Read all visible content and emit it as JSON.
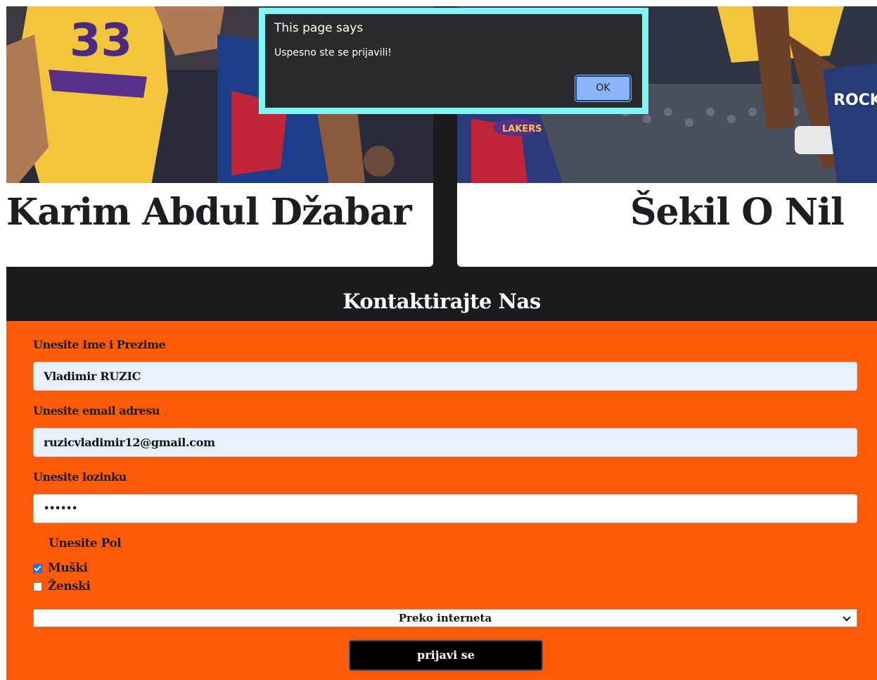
{
  "cards": [
    {
      "name": "Karim Abdul Džabar"
    },
    {
      "name": "Šekil O Nil"
    }
  ],
  "contact": {
    "title": "Kontaktirajte Nas"
  },
  "form": {
    "name_label": "Unesite Ime i Prezime",
    "name_value": "Vladimir RUZIC",
    "email_label": "Unesite email adresu",
    "email_value": "ruzicvladimir12@gmail.com",
    "password_label": "Unesite lozinku",
    "password_value": "••••••",
    "gender_label": "Unesite Pol",
    "gender_options": [
      {
        "label": "Muški",
        "checked": true
      },
      {
        "label": "Ženski",
        "checked": false
      }
    ],
    "source_selected": "Preko interneta",
    "submit_label": "prijavi se"
  },
  "dialog": {
    "title": "This page says",
    "message": "Uspesno ste se prijavili!",
    "ok_label": "OK"
  },
  "colors": {
    "form_bg": "#ff5a05",
    "dark_bg": "#1b1b1d",
    "dialog_border": "#7ff5f5",
    "ok_button": "#8ab4f8",
    "autofill_bg": "#e8f0fe"
  }
}
